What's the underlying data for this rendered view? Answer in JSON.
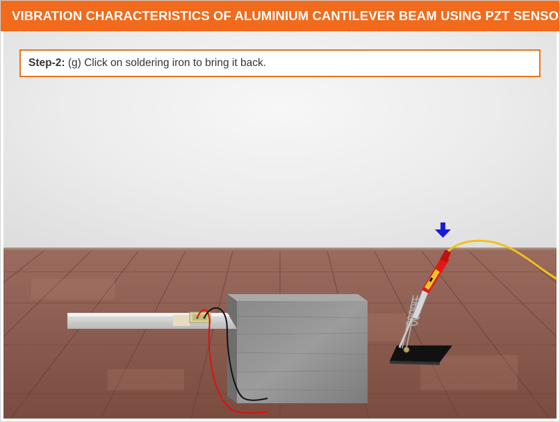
{
  "header": {
    "title": "VIBRATION CHARACTERISTICS OF ALUMINIUM CANTILEVER BEAM USING PZT SENSOR"
  },
  "instruction": {
    "step_label": "Step-2:",
    "step_text": " (g) Click on soldering iron to bring it back."
  },
  "colors": {
    "accent": "#f26a1b",
    "hint_arrow": "#1a1adc",
    "red_wire": "#e01010",
    "black_wire": "#111111",
    "iron_cable": "#f2c21a"
  },
  "icons": {
    "hint": "arrow-down-icon"
  }
}
